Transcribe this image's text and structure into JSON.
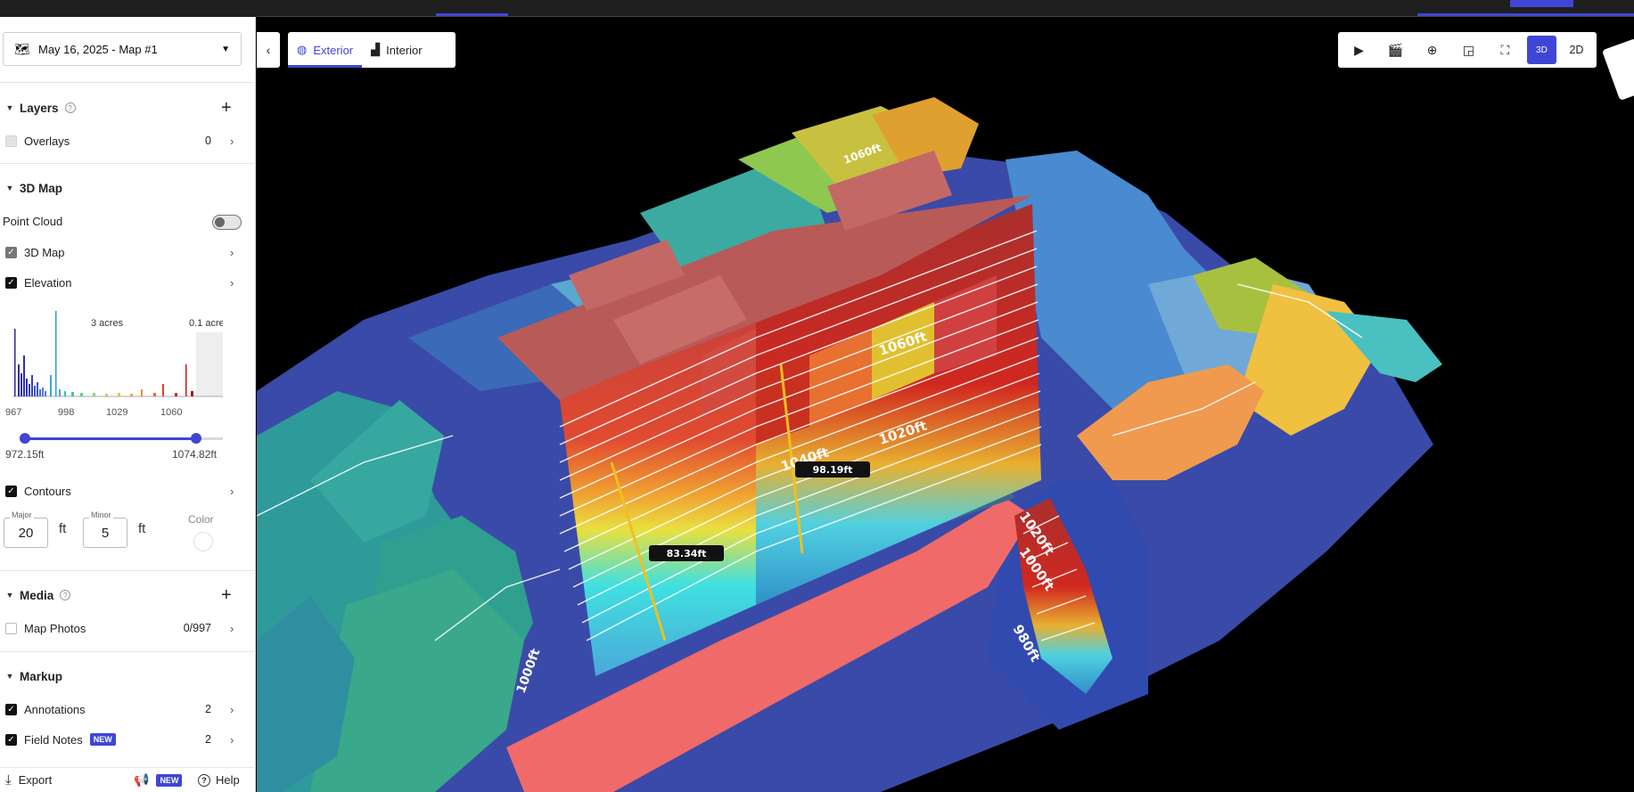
{
  "app": {
    "colors": {
      "accent": "#3f46d6",
      "sidebar_bg": "#ffffff",
      "map_bg": "#000000"
    }
  },
  "sidebar": {
    "map_select": {
      "label": "May 16, 2025 - Map #1",
      "icon": "map-flag-icon"
    },
    "layers": {
      "title": "Layers",
      "overlays": {
        "label": "Overlays",
        "count": "0"
      }
    },
    "map3d": {
      "title": "3D Map",
      "point_cloud": {
        "label": "Point Cloud",
        "enabled": false
      },
      "map3d_row": {
        "label": "3D Map"
      },
      "elevation": {
        "label": "Elevation",
        "histogram": {
          "annot_left": "3 acres",
          "annot_right": "0.1 acre",
          "ticks": [
            "967",
            "998",
            "1029",
            "1060"
          ],
          "range_min": "972.15ft",
          "range_max": "1074.82ft"
        }
      },
      "contours": {
        "label": "Contours",
        "major_label": "Major",
        "major_value": "20",
        "minor_label": "Minor",
        "minor_value": "5",
        "unit": "ft",
        "color_label": "Color"
      }
    },
    "media": {
      "title": "Media",
      "photos": {
        "label": "Map Photos",
        "count": "0/997"
      }
    },
    "markup": {
      "title": "Markup",
      "annotations": {
        "label": "Annotations",
        "count": "2"
      },
      "field_notes": {
        "label": "Field Notes",
        "badge": "NEW",
        "count": "2"
      }
    },
    "footer": {
      "export": "Export",
      "news_badge": "NEW",
      "help": "Help"
    }
  },
  "map": {
    "tabs": [
      {
        "label": "Exterior",
        "active": true,
        "icon": "globe-icon"
      },
      {
        "label": "Interior",
        "active": false,
        "icon": "floorplan-icon"
      }
    ],
    "toolbar": {
      "mode_2d": "2D",
      "mode_3d": "3D"
    },
    "measurements": [
      "83.34ft",
      "98.19ft"
    ],
    "contour_labels": [
      "1060ft",
      "1020ft",
      "1040ft",
      "1020ft",
      "1000ft",
      "980ft",
      "1060ft",
      "1000ft"
    ]
  }
}
